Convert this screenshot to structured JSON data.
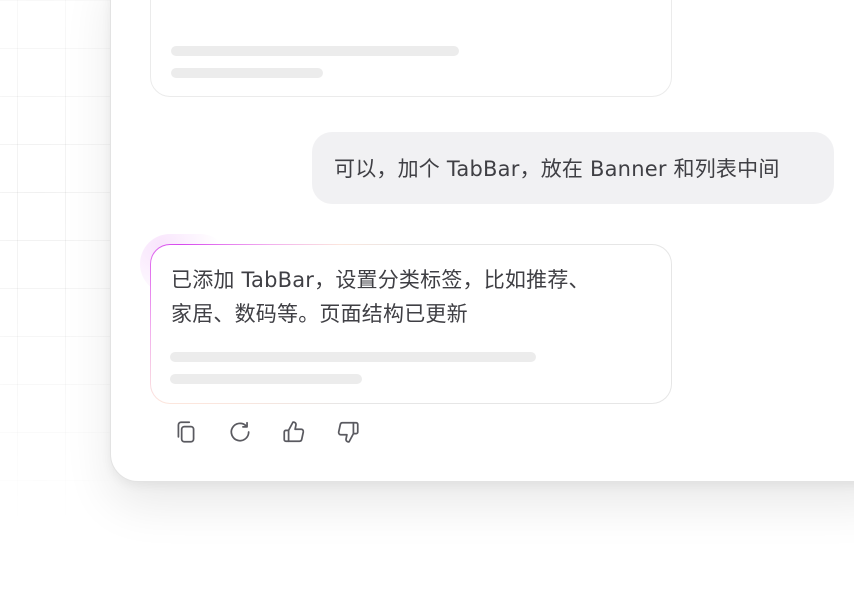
{
  "conversation": {
    "previous_ai_card": {
      "skeleton_lines": 2
    },
    "user_message": {
      "text": "可以，加个 TabBar，放在 Banner 和列表中间"
    },
    "ai_message": {
      "line1": "已添加 TabBar，设置分类标签，比如推荐、",
      "line2": "家居、数码等。页面结构已更新",
      "skeleton_lines": 2
    }
  },
  "actions": [
    {
      "icon": "copy-icon"
    },
    {
      "icon": "refresh-icon"
    },
    {
      "icon": "thumbs-up-icon"
    },
    {
      "icon": "thumbs-down-icon"
    }
  ],
  "colors": {
    "accent_gradient_start": "#d648ee",
    "accent_gradient_end": "#f8c8b4",
    "user_bubble_bg": "#f1f1f3",
    "text": "#3f3f44",
    "skeleton": "#ececec"
  }
}
